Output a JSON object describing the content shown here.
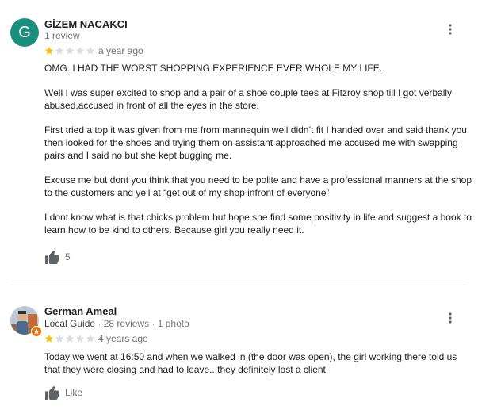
{
  "colors": {
    "star_filled": "#fbbc04",
    "star_empty": "#dadce0",
    "avatar_bg": "#1a8f7e",
    "muted_text": "#70757a",
    "icon": "#5f6368",
    "guide_badge": "#e8710a"
  },
  "reviews": [
    {
      "avatar_letter": "G",
      "author": "GİZEM NACAKCI",
      "meta": "1 review",
      "rating": 1,
      "max_rating": 5,
      "time": "a year ago",
      "paragraphs": [
        "OMG. I HAD THE WORST SHOPPING EXPERIENCE EVER WHOLE MY LIFE.",
        "Well I was super excited to shop and a pair of a shoe couple tees at Fitzroy shop till I got verbally abused,accused in front of all the eyes in the store.",
        "First tried a top it was given from me from mannequin well didn’t fit I handed over and said thank you then looked for the shoes and trying them on assistant approached me accused me with swapping pairs and I said no but she kept bugging me.",
        "Excuse me but dont you think that you need to be polite and have a professional manners at the shop to the customers and yell at “get out of my shop infront of everyone”",
        "I dont know what is that chicks problem but hope she find some positivity in life and suggest a book to learn how to be kind to others. Because girl you really need it."
      ],
      "like_label": "5",
      "more_icon": "more-vert-icon",
      "like_icon": "thumb-up-icon"
    },
    {
      "author": "German Ameal",
      "meta_badge": "Local Guide",
      "meta_rest": " · 28 reviews · 1 photo",
      "rating": 1,
      "max_rating": 5,
      "time": "4 years ago",
      "paragraphs": [
        "Today we went at 16:50 and when we walked in (the door was open), the girl working there told us that they were closing and had to leave.. they definitely lost a client"
      ],
      "like_label": "Like",
      "more_icon": "more-vert-icon",
      "like_icon": "thumb-up-icon"
    }
  ]
}
